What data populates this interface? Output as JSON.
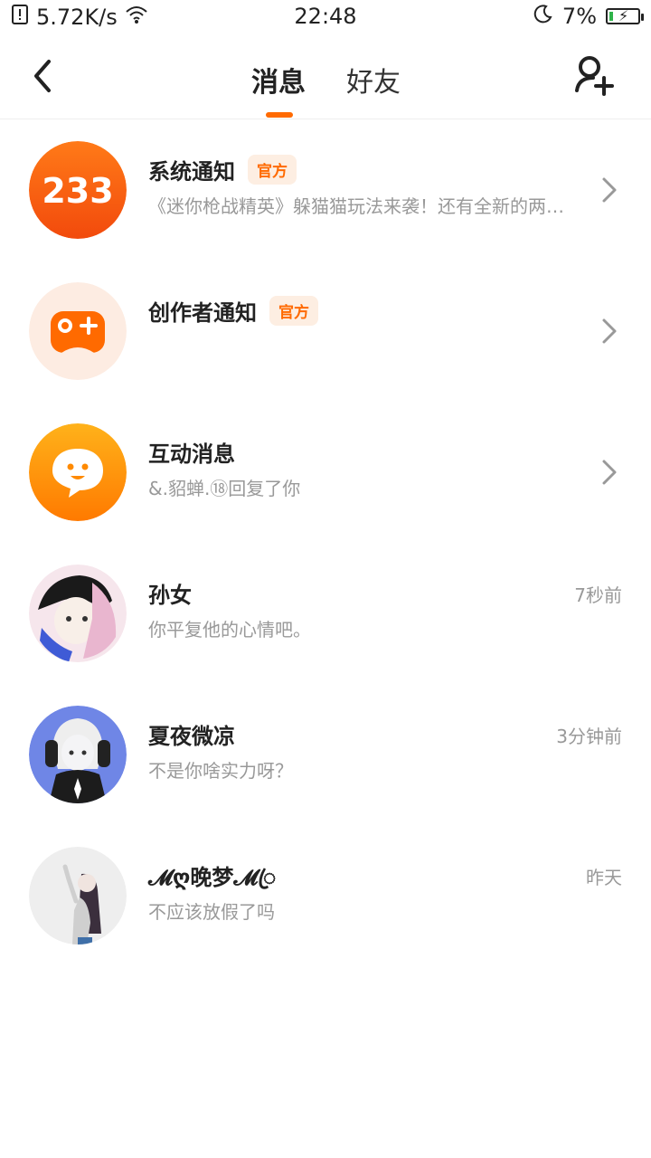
{
  "status_bar": {
    "net_speed": "5.72K/s",
    "time": "22:48",
    "battery": "7%",
    "battery_level": 0.07
  },
  "header": {
    "tabs": [
      {
        "label": "消息",
        "active": true
      },
      {
        "label": "好友",
        "active": false
      }
    ],
    "accent_color": "#ff6a00"
  },
  "messages": [
    {
      "name": "系统通知",
      "badge": "官方",
      "preview": "《迷你枪战精英》躲猫猫玩法来袭！还有全新的两…",
      "avatar_text": "233"
    },
    {
      "name": "创作者通知",
      "badge": "官方",
      "preview": ""
    },
    {
      "name": "互动消息",
      "preview": "&.貂蝉.⑱回复了你"
    },
    {
      "name": "孙女",
      "preview": "你平复他的心情吧。",
      "time": "7秒前"
    },
    {
      "name": "夏夜微凉",
      "preview": "不是你啥实力呀？",
      "time": "3分钟前"
    },
    {
      "name": "𝓜ღ晚梦𝓜ꦿ",
      "preview": "不应该放假了吗",
      "time": "昨天"
    }
  ]
}
